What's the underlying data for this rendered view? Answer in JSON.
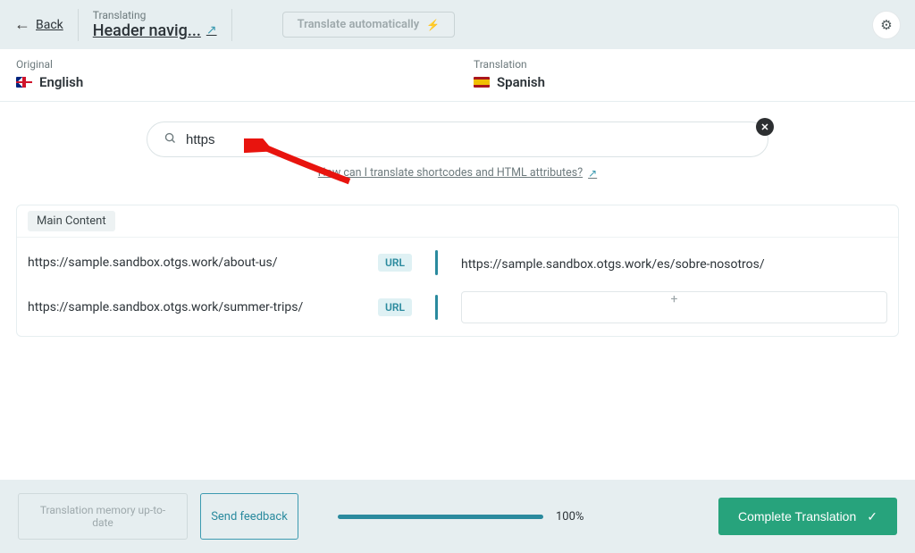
{
  "header": {
    "back_label": "Back",
    "status": "Translating",
    "title": "Header navig...",
    "auto_translate_label": "Translate automatically"
  },
  "languages": {
    "original_label": "Original",
    "original_value": "English",
    "translation_label": "Translation",
    "translation_value": "Spanish"
  },
  "search": {
    "value": "https",
    "help_text": "How can I translate shortcodes and HTML attributes?"
  },
  "content": {
    "section_label": "Main Content",
    "url_chip": "URL",
    "rows": [
      {
        "source": "https://sample.sandbox.otgs.work/about-us/",
        "target": "https://sample.sandbox.otgs.work/es/sobre-nosotros/"
      },
      {
        "source": "https://sample.sandbox.otgs.work/summer-trips/",
        "target": ""
      }
    ],
    "empty_placeholder": "+"
  },
  "footer": {
    "tm_status": "Translation memory up-to-date",
    "feedback_label": "Send feedback",
    "progress_percent": "100%",
    "complete_label": "Complete Translation"
  }
}
